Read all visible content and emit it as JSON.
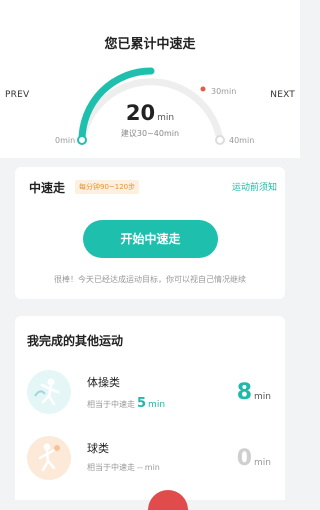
{
  "header": {
    "title": "您已累计中速走",
    "prev_label": "PREV",
    "next_label": "NEXT"
  },
  "gauge": {
    "value": "20",
    "unit": "min",
    "hint": "建议30~40min",
    "min_label": "0min",
    "mid_label": "30min",
    "max_label": "40min",
    "progress_fraction": 0.5,
    "accent_color": "#1fbfae"
  },
  "activity_card": {
    "name": "中速走",
    "badge": "每分钟90~120步",
    "notice_link": "运动前须知",
    "start_button": "开始中速走",
    "message": "很棒！今天已经达成运动目标，你可以视自己情况继续"
  },
  "other_card": {
    "heading": "我完成的其他运动",
    "items": [
      {
        "label": "体操类",
        "sub_prefix": "相当于中速走",
        "sub_value": "5",
        "sub_unit": "min",
        "total": "8",
        "total_unit": "min",
        "icon": "gymnastics-icon"
      },
      {
        "label": "球类",
        "sub_prefix": "相当于中速走",
        "sub_value": "--",
        "sub_unit": "min",
        "total": "0",
        "total_unit": "min",
        "icon": "ball-sport-icon"
      }
    ]
  }
}
